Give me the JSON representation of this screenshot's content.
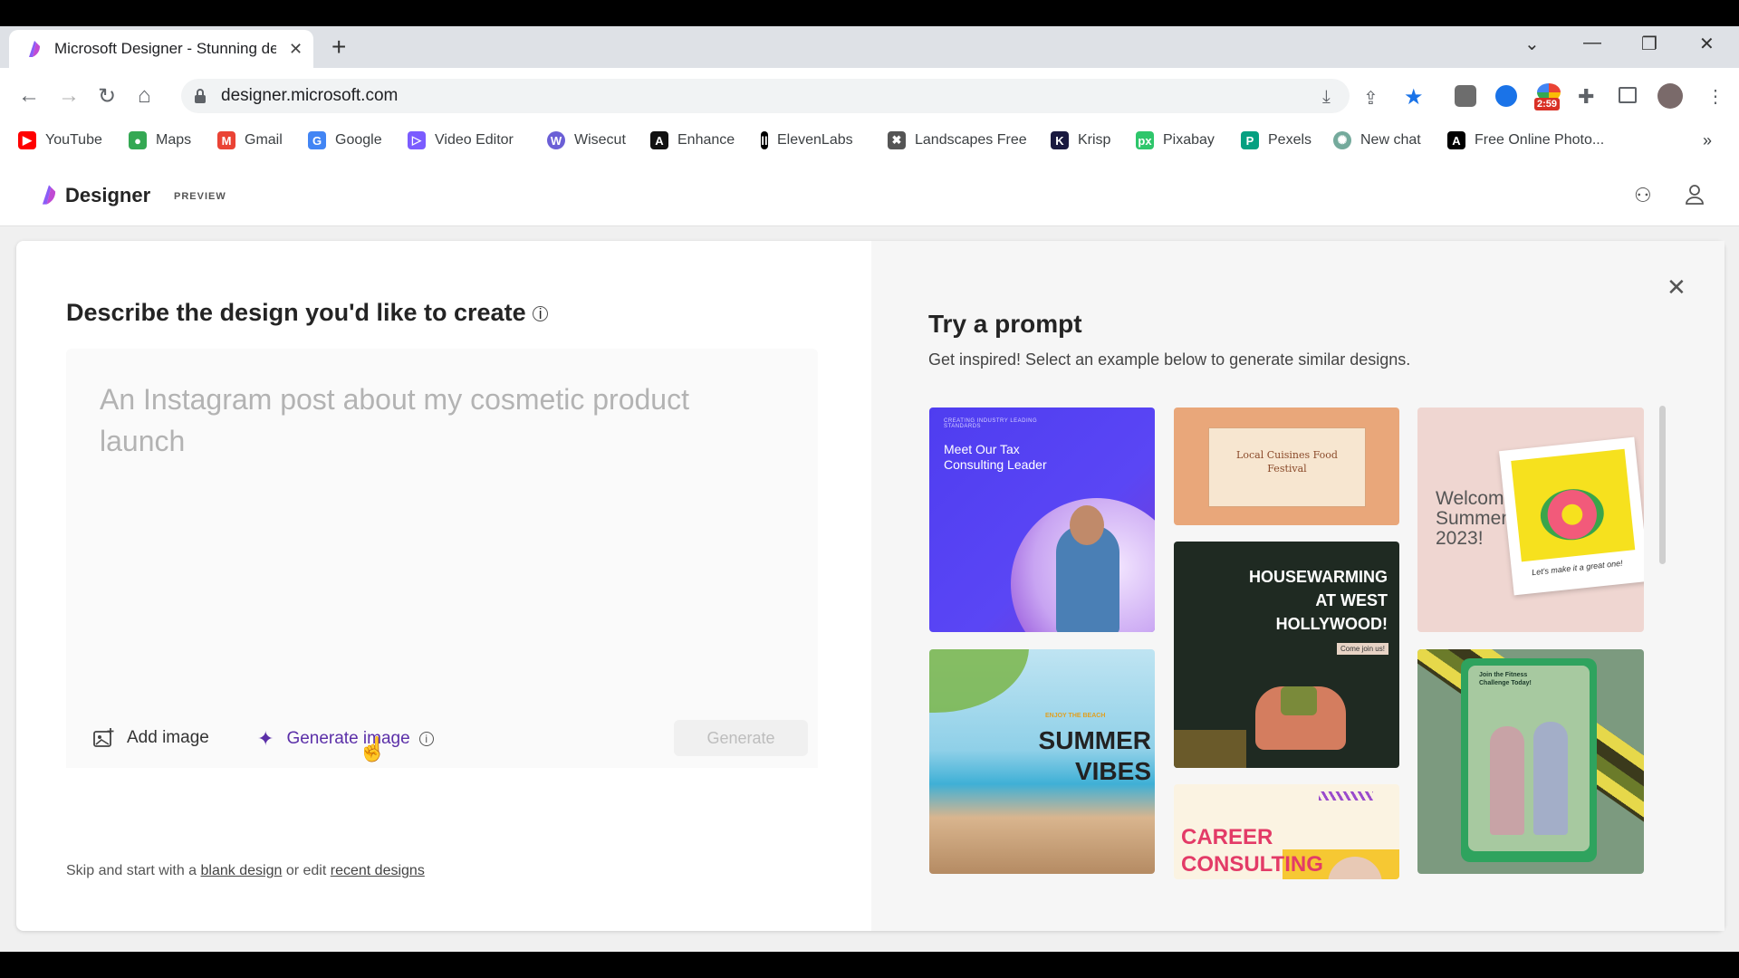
{
  "browser": {
    "tab_title": "Microsoft Designer - Stunning de",
    "url": "designer.microsoft.com",
    "extension_badge": "2:59",
    "bookmarks": [
      {
        "label": "YouTube",
        "icon": "youtube-icon",
        "color": "#ff0000"
      },
      {
        "label": "Maps",
        "icon": "maps-icon",
        "color": "#34a853"
      },
      {
        "label": "Gmail",
        "icon": "gmail-icon",
        "color": "#ea4335"
      },
      {
        "label": "Google",
        "icon": "google-icon",
        "color": "#4285f4"
      },
      {
        "label": "Video Editor",
        "icon": "video-editor-icon",
        "color": "#7b5cff"
      },
      {
        "label": "Wisecut",
        "icon": "wisecut-icon",
        "color": "#6b5fd6"
      },
      {
        "label": "Enhance",
        "icon": "enhance-icon",
        "color": "#111111"
      },
      {
        "label": "ElevenLabs",
        "icon": "elevenlabs-icon",
        "color": "#000000"
      },
      {
        "label": "Landscapes Free",
        "icon": "landscapes-icon",
        "color": "#555555"
      },
      {
        "label": "Krisp",
        "icon": "krisp-icon",
        "color": "#1a1a40"
      },
      {
        "label": "Pixabay",
        "icon": "pixabay-icon",
        "color": "#2ec66b"
      },
      {
        "label": "Pexels",
        "icon": "pexels-icon",
        "color": "#05a081"
      },
      {
        "label": "New chat",
        "icon": "chat-icon",
        "color": "#74aa9c"
      },
      {
        "label": "Free Online Photo...",
        "icon": "adobe-icon",
        "color": "#000000"
      }
    ]
  },
  "app": {
    "logo": "Designer",
    "badge": "PREVIEW"
  },
  "main": {
    "heading": "Describe the design you'd like to create",
    "prompt_placeholder": "An Instagram post about my cosmetic product launch",
    "add_image_label": "Add image",
    "generate_image_label": "Generate image",
    "generate_button": "Generate",
    "skip_prefix": "Skip and start with a",
    "blank_design_link": "blank design",
    "skip_middle": "or edit",
    "recent_designs_link": "recent designs"
  },
  "prompts": {
    "title": "Try a prompt",
    "subtitle": "Get inspired! Select an example below to generate similar designs.",
    "tiles": {
      "tax": {
        "small": "CREATING INDUSTRY LEADING STANDARDS",
        "text": "Meet Our Tax Consulting Leader"
      },
      "food": {
        "text": "Local Cuisines Food Festival"
      },
      "summer2023": {
        "text": "Welcome Summer 2023!",
        "caption": "Let's make it a great one!"
      },
      "housewarming": {
        "text": "HOUSEWARMING AT WEST HOLLYWOOD!",
        "tag": "Come join us!"
      },
      "vibes": {
        "small": "ENJOY THE BEACH",
        "text": "SUMMER VIBES"
      },
      "fitness": {
        "text": "Join the Fitness Challenge Today!"
      },
      "career": {
        "text": "CAREER CONSULTING"
      }
    }
  },
  "colors": {
    "accent": "#5b2fa8",
    "tax_bg": "#4f3df0",
    "food_bg": "#e9a77a"
  }
}
